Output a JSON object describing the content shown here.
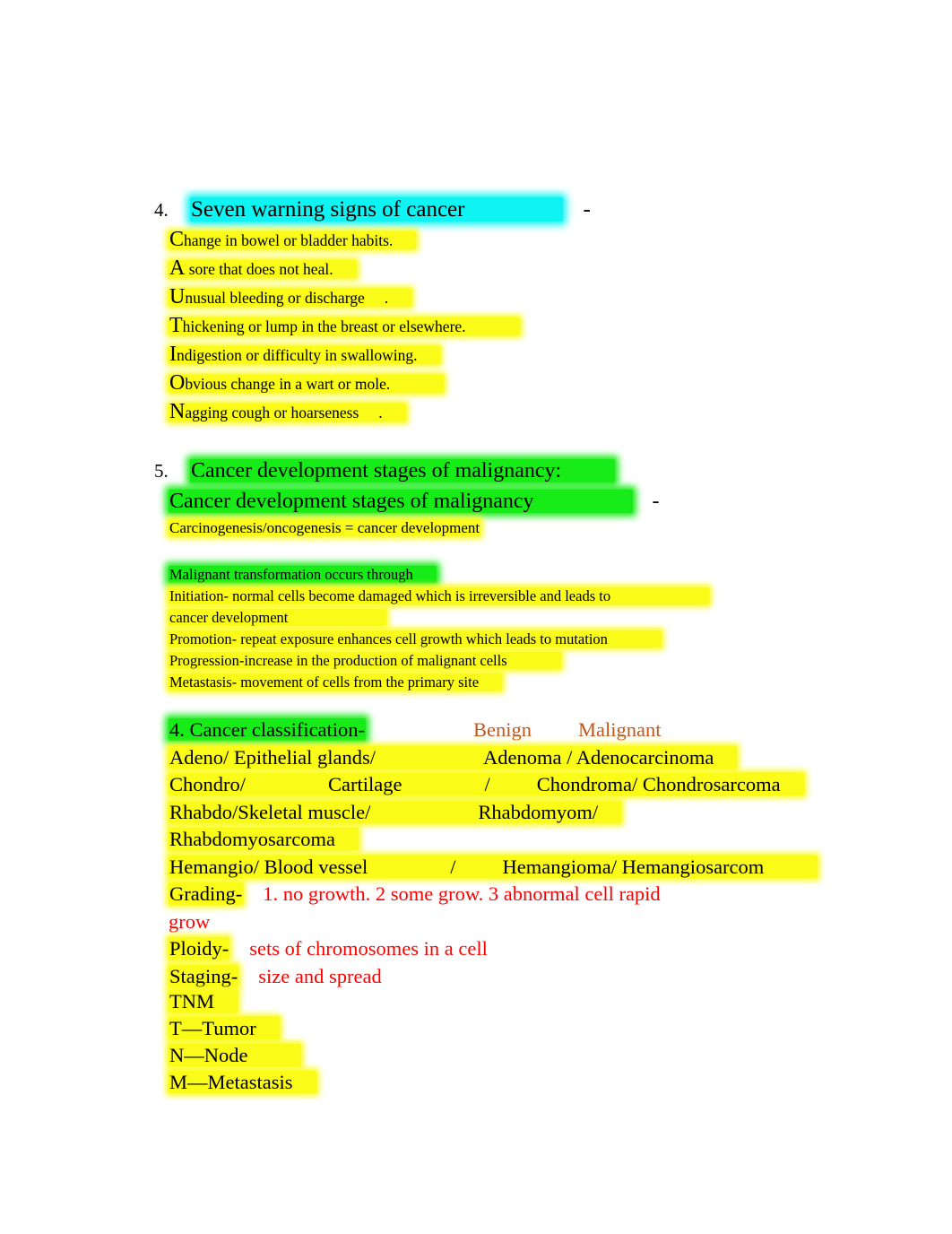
{
  "document": {
    "title": "Cancer study notes page",
    "colors": {
      "highlight_yellow": "#fbfb19",
      "highlight_cyan": "#0ff3f3",
      "highlight_green": "#18ec18",
      "text_red": "#ff0000",
      "text_orange": "#c0571a",
      "text_black": "#000000",
      "page_background": "#ffffff"
    }
  },
  "section_4": {
    "number": "4.",
    "heading": "Seven warning signs of cancer",
    "trailing_dash": "-",
    "items": [
      {
        "cap": "C",
        "rest": "hange in bowel or bladder habits."
      },
      {
        "cap": "A",
        "rest": " sore that does not heal."
      },
      {
        "cap": "U",
        "rest": "nusual    bleeding      or  discharge"
      },
      {
        "cap": "U",
        "rest_tail": "."
      },
      {
        "cap": "T",
        "rest": "hickening or lump in the breast or elsewhere."
      },
      {
        "cap": "I",
        "rest": "ndigestion        or difficulty in swallowing."
      },
      {
        "cap": "O",
        "rest": "bvious change in a wart or mole."
      },
      {
        "cap": "N",
        "rest": "agging    cough     or  hoarseness"
      },
      {
        "cap": "N",
        "rest_tail": "."
      }
    ],
    "lines": [
      {
        "cap": "C",
        "text": "hange in bowel or bladder habits.",
        "tail": ""
      },
      {
        "cap": "A",
        "text": " sore that does not heal.",
        "tail": ""
      },
      {
        "cap": "U",
        "text": "nusual    bleeding      or  discharge",
        "tail": "."
      },
      {
        "cap": "T",
        "text": "hickening or lump in the breast or elsewhere.",
        "tail": ""
      },
      {
        "cap": "I",
        "text": "ndigestion        or difficulty in swallowing.",
        "tail": ""
      },
      {
        "cap": "O",
        "text": "bvious change in a wart or mole.",
        "tail": ""
      },
      {
        "cap": "N",
        "text": "agging    cough     or  hoarseness",
        "tail": "."
      }
    ]
  },
  "section_5": {
    "number": "5.",
    "heading": "Cancer development stages of malignancy:",
    "subheading": "Cancer development stages of malignancy",
    "subheading_dash": "-",
    "definition": "Carcinogenesis/oncogenesis = cancer development",
    "transformation_heading": "Malignant transformation occurs through",
    "transformation_lines": [
      "Initiation- normal cells become damaged which is irreversible and leads to",
      "cancer development",
      "Promotion- repeat exposure enhances cell growth which leads to mutation",
      "Progression-increase in the production of malignant cells",
      "Metastasis- movement of cells from the primary site"
    ]
  },
  "classification": {
    "heading": "4. Cancer classification-",
    "col_benign": "Benign",
    "col_malignant": "Malignant",
    "rows": [
      {
        "prefix": "Adeno/ Epithelial glands/",
        "mid": "",
        "value": "Adenoma / Adenocarcinoma"
      },
      {
        "prefix": "Chondro/",
        "mid": "Cartilage",
        "slash": "/",
        "value": "Chondroma/ Chondrosarcoma"
      },
      {
        "prefix": "Rhabdo/Skeletal muscle/",
        "mid": "",
        "value": "Rhabdomyom/"
      },
      {
        "prefix": "Rhabdomyosarcoma",
        "mid": "",
        "value": ""
      },
      {
        "prefix": "Hemangio/ Blood vessel",
        "mid": "",
        "slash": "/",
        "value": "Hemangioma/ Hemangiosarcom"
      }
    ],
    "grading_label": "Grading-",
    "grading_value": "1. no    growth. 2 some grow. 3 abnormal cell rapid",
    "grading_value_wrap": "grow",
    "ploidy_label": "Ploidy-",
    "ploidy_value": "sets of chromosomes in a cell",
    "staging_label": "Staging-",
    "staging_value": "size and spread"
  },
  "tnm": {
    "title": "TNM",
    "t": "T—Tumor",
    "n": "N—Node",
    "m": "M—Metastasis"
  }
}
